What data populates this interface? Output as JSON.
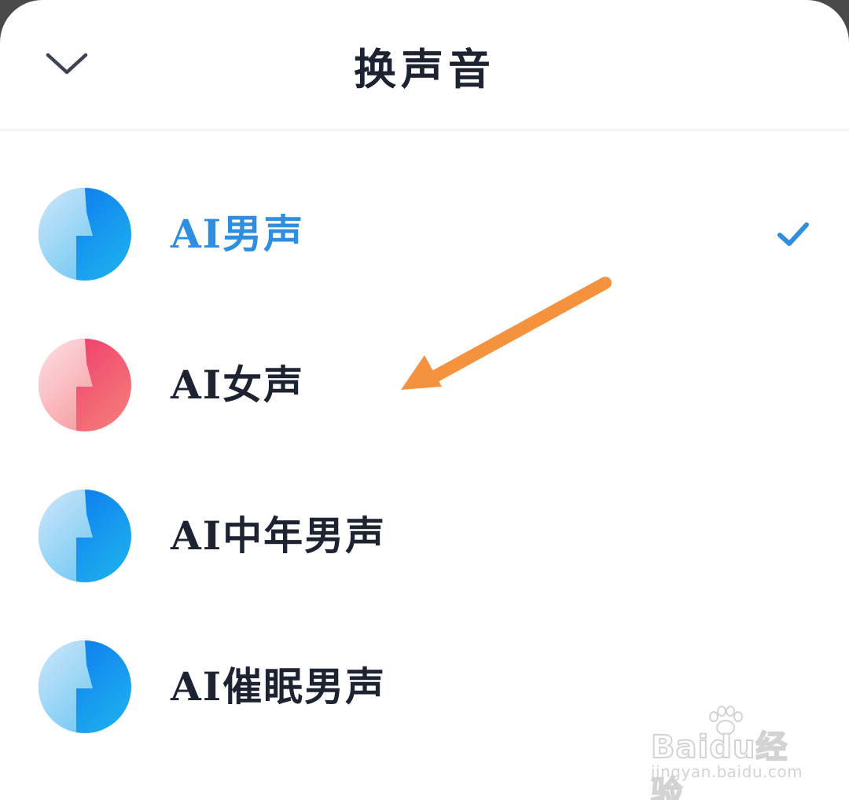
{
  "header": {
    "title": "换声音",
    "collapse_icon": "chevron-down-icon"
  },
  "voices": [
    {
      "label": "AI男声",
      "selected": true,
      "color": "blue"
    },
    {
      "label": "AI女声",
      "selected": false,
      "color": "pink"
    },
    {
      "label": "AI中年男声",
      "selected": false,
      "color": "blue"
    },
    {
      "label": "AI催眠男声",
      "selected": false,
      "color": "blue"
    }
  ],
  "colors": {
    "accent": "#2f8ee0",
    "text": "#1d2330",
    "arrow": "#f5923e",
    "divider": "#e6e6e6"
  },
  "watermark": {
    "logo": "Baidu经验",
    "url": "jingyan.baidu.com"
  }
}
